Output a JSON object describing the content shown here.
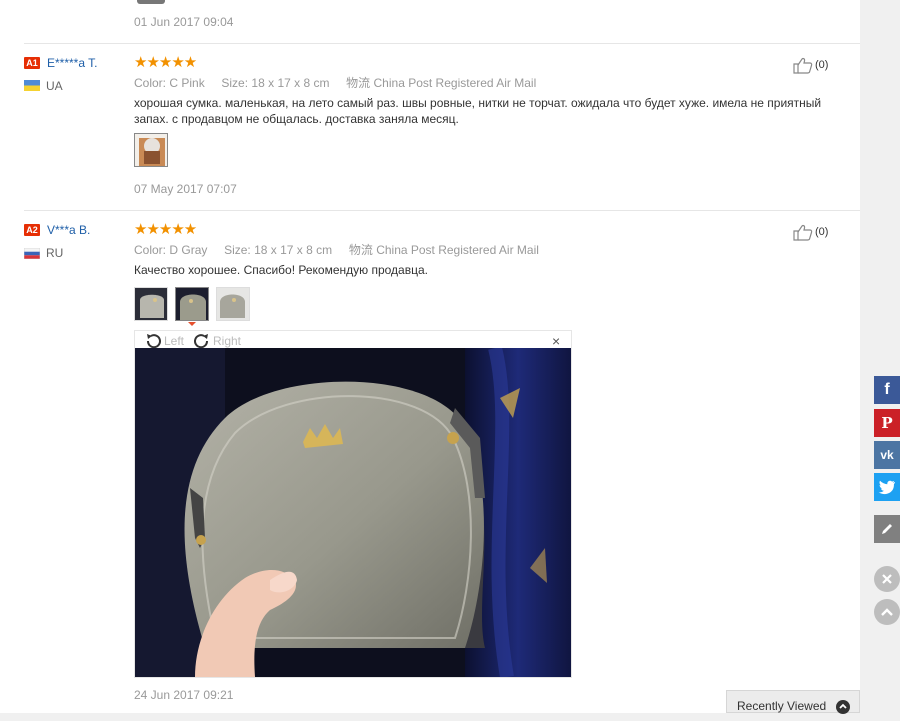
{
  "top": {
    "date": "01 Jun 2017 09:04"
  },
  "reviews": [
    {
      "badge": "A1",
      "user": "E*****a T.",
      "country": "UA",
      "rating": 5,
      "stars": "★★★★★",
      "color_label": "Color:",
      "color": "C Pink",
      "size_label": "Size:",
      "size": "18 x 17 x 8 cm",
      "shipping_label": "物流",
      "shipping": "China Post Registered Air Mail",
      "text": "хорошая сумка. маленькая, на лето самый раз. швы ровные, нитки не торчат. ожидала что будет хуже. имела не приятный запах. с продавцом не общалась. доставка заняла месяц.",
      "likes": "(0)",
      "date": "07 May 2017 07:07"
    },
    {
      "badge": "A2",
      "user": "V***a B.",
      "country": "RU",
      "rating": 5,
      "stars": "★★★★★",
      "color_label": "Color:",
      "color": "D Gray",
      "size_label": "Size:",
      "size": "18 x 17 x 8 cm",
      "shipping_label": "物流",
      "shipping": "China Post Registered Air Mail",
      "text": "Качество хорошее. Спасибо! Рекомендую продавца.",
      "likes": "(0)",
      "date": "24 Jun 2017 09:21"
    }
  ],
  "viewer": {
    "rotate_left": "Left",
    "rotate_right": "Right",
    "close": "×"
  },
  "social": {
    "facebook": "f",
    "pinterest": "P",
    "vk": "vk"
  },
  "recently_viewed": "Recently Viewed",
  "colors": {
    "accent": "#e62e04",
    "star": "#f29100",
    "link": "#1f5fa8",
    "facebook": "#3b5998",
    "pinterest": "#cb2027",
    "vk": "#4c75a3",
    "twitter": "#1da1f2"
  }
}
